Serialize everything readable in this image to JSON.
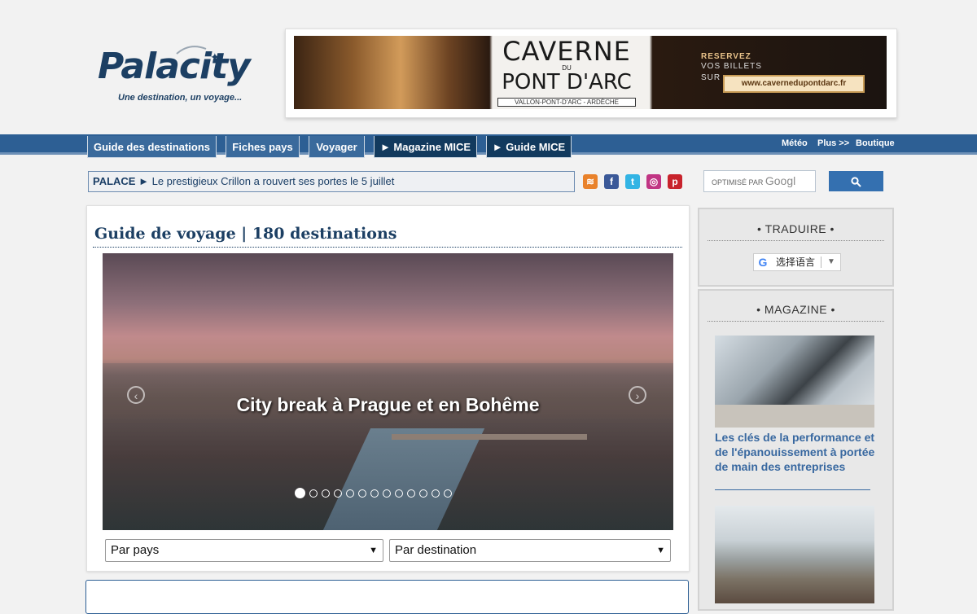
{
  "brand": {
    "logo_text": "Palacity",
    "tagline": "Une destination, un voyage..."
  },
  "banner_ad": {
    "title": "CAVERNE",
    "du": "DU",
    "subtitle": "PONT D'ARC",
    "location": "VALLON-PONT-D'ARC - ARDÈCHE",
    "reservez": "RESERVEZ",
    "vos_billets": "VOS BILLETS",
    "sur": "SUR",
    "url": "www.cavernedupontdarc.fr"
  },
  "nav": {
    "tabs": [
      {
        "label": "Guide des destinations"
      },
      {
        "label": "Fiches pays"
      },
      {
        "label": "Voyager"
      },
      {
        "label": "► Magazine MICE"
      },
      {
        "label": "► Guide MICE"
      }
    ],
    "links": [
      "Météo",
      "Plus >>",
      "Boutique"
    ]
  },
  "ticker": {
    "label": "PALACE",
    "arrow": "►",
    "text": "Le prestigieux Crillon a rouvert ses portes le 5 juillet"
  },
  "social": [
    {
      "icon": "rss-icon",
      "glyph": "≋",
      "color": "#e9822b"
    },
    {
      "icon": "facebook-icon",
      "glyph": "f",
      "color": "#3b5998"
    },
    {
      "icon": "twitter-icon",
      "glyph": "t",
      "color": "#33b4e4"
    },
    {
      "icon": "instagram-icon",
      "glyph": "◎",
      "color": "#c13584"
    },
    {
      "icon": "pinterest-icon",
      "glyph": "p",
      "color": "#c8232c"
    }
  ],
  "search": {
    "prefix": "OPTIMISÉ PAR",
    "brand": "Googl",
    "button_icon": "search-icon",
    "button_glyph": "🔍"
  },
  "main": {
    "title": "Guide de voyage | 180 destinations",
    "slider": {
      "caption": "City break à Prague et en Bohême",
      "prev_glyph": "‹",
      "next_glyph": "›",
      "dot_count": 13,
      "active_dot": 1
    },
    "select_country": "Par pays",
    "select_destination": "Par destination"
  },
  "sidebar": {
    "translate": {
      "title": "• TRADUIRE •",
      "widget_label": "选择语言",
      "widget_arrow": "▼"
    },
    "magazine": {
      "title": "• MAGAZINE •",
      "article1": "Les clés de la performance et de l'épanouissement à portée de main des entreprises"
    }
  }
}
